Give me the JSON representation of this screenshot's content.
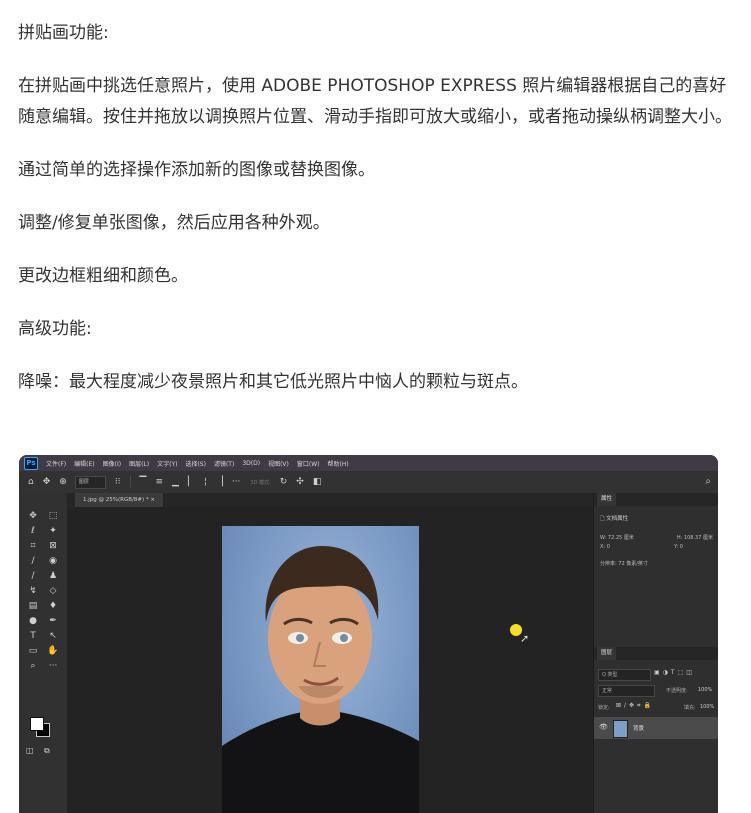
{
  "article": {
    "heading1": "拼贴画功能:",
    "para1": "在拼贴画中挑选任意照片，使用 ADOBE PHOTOSHOP EXPRESS 照片编辑器根据自己的喜好随意编辑。按住并拖放以调换照片位置、滑动手指即可放大或缩小，或者拖动操纵柄调整大小。",
    "para2": "通过简单的选择操作添加新的图像或替换图像。",
    "para3": "调整/修复单张图像，然后应用各种外观。",
    "para4": "更改边框粗细和颜色。",
    "heading2": "高级功能:",
    "para5": "降噪：最大程度减少夜景照片和其它低光照片中恼人的颗粒与斑点。"
  },
  "photoshop": {
    "logo": "Ps",
    "menus": [
      "文件(F)",
      "编辑(E)",
      "图像(I)",
      "图层(L)",
      "文字(Y)",
      "选择(S)",
      "滤镜(T)",
      "3D(D)",
      "视图(V)",
      "窗口(W)",
      "帮助(H)"
    ],
    "options": {
      "field": "图层",
      "mode3d": "3D 模式:"
    },
    "tab": "1.jpg @ 25%(RGB/8#) * ×",
    "properties": {
      "tab": "属性",
      "doc": "文档属性",
      "w": "W: 72.25 厘米",
      "h": "H: 108.37 厘米",
      "x": "X: 0",
      "y": "Y: 0",
      "resolution": "分辨率: 72 像素/英寸"
    },
    "layers": {
      "tab": "图层",
      "search": "Q 类型",
      "blend": "正常",
      "opacity_label": "不透明度:",
      "opacity": "100%",
      "lock_label": "锁定:",
      "fill_label": "填充:",
      "fill": "100%",
      "layer_name": "背景"
    }
  }
}
